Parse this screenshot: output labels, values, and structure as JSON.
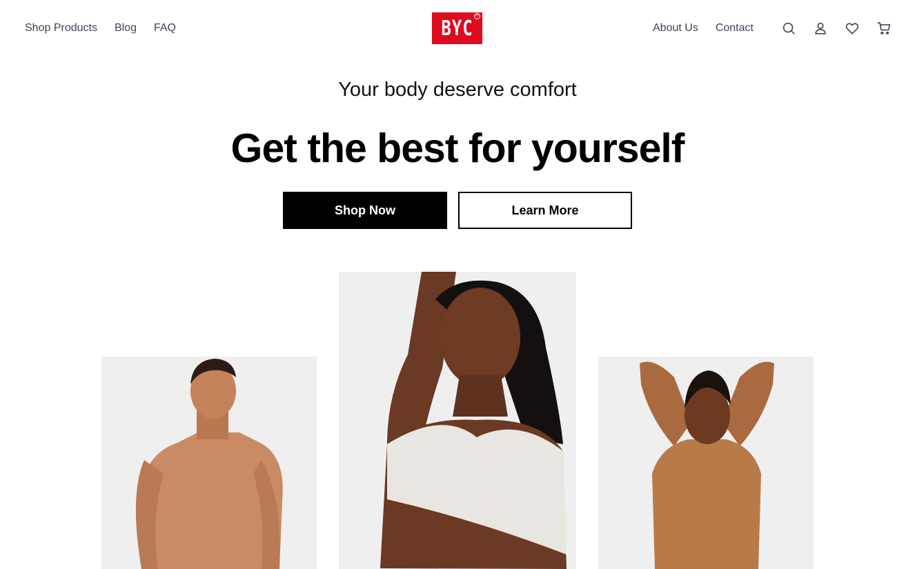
{
  "header": {
    "nav_left": [
      {
        "label": "Shop Products"
      },
      {
        "label": "Blog"
      },
      {
        "label": "FAQ"
      }
    ],
    "logo_text": "BYC",
    "nav_right": [
      {
        "label": "About Us"
      },
      {
        "label": "Contact"
      }
    ],
    "icons": [
      "search-icon",
      "user-icon",
      "heart-icon",
      "cart-icon"
    ]
  },
  "hero": {
    "tagline": "Your body deserve comfort",
    "headline": "Get the best for yourself",
    "primary_button": "Shop Now",
    "secondary_button": "Learn More"
  },
  "colors": {
    "brand_red": "#df0a1d",
    "primary_button_bg": "#000000",
    "photo_bg": "#efefef"
  },
  "gallery": {
    "items": [
      "man-model-photo",
      "woman-model-photo",
      "man-model-photo"
    ]
  }
}
